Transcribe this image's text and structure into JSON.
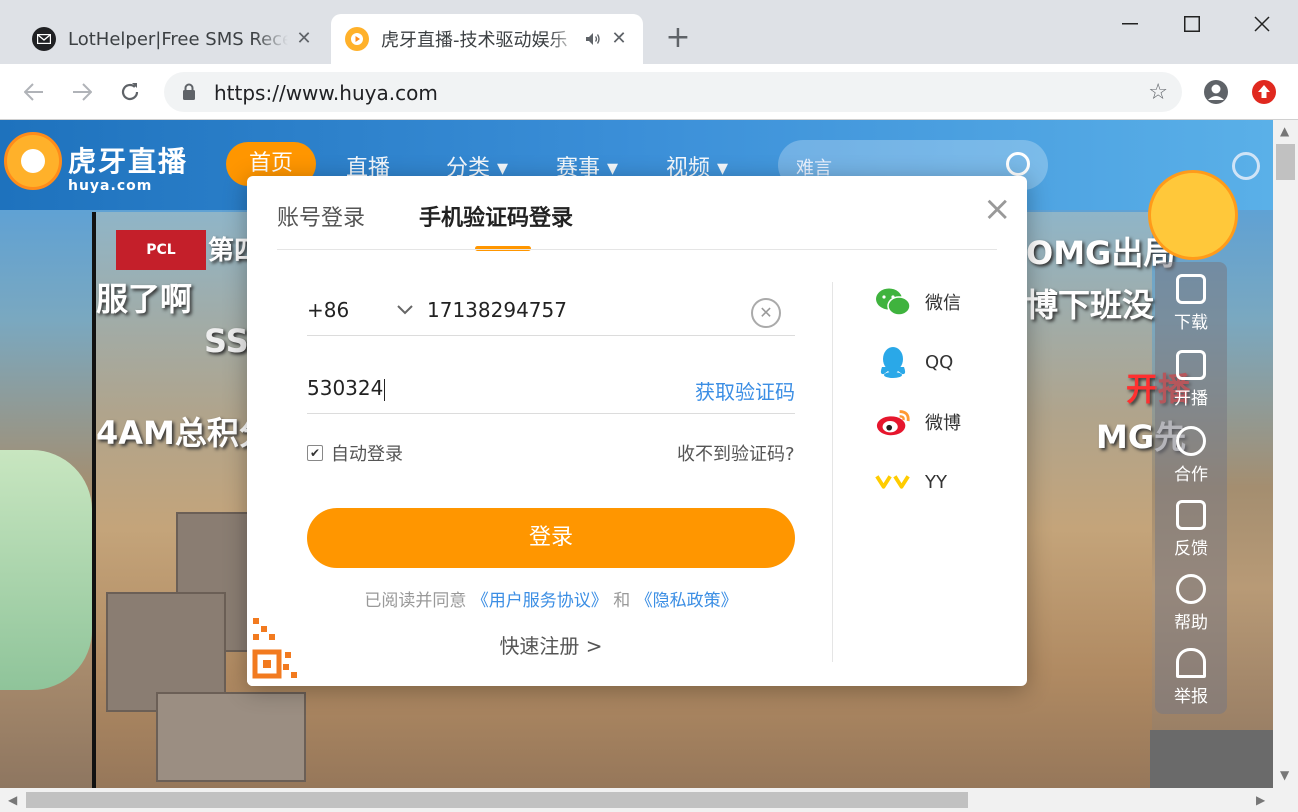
{
  "browser": {
    "tabs": [
      {
        "title": "LotHelper|Free SMS Receive",
        "active": false
      },
      {
        "title": "虎牙直播-技术驱动娱乐",
        "active": true
      }
    ],
    "url": "https://www.huya.com"
  },
  "site": {
    "brand": "虎牙直播",
    "brand_sub": "huya.com",
    "nav": [
      "首页",
      "直播",
      "分类",
      "赛事",
      "视频"
    ],
    "search_placeholder": "难言",
    "side_panel": [
      "下载",
      "开播",
      "合作",
      "反馈",
      "帮助",
      "举报"
    ],
    "overlay": {
      "pcl": "PCL",
      "round": "第四",
      "line1": "服了啊",
      "line2": "SSS",
      "line3": "4AM总积分",
      "right1": "OMG出局",
      "right2": "博下班没",
      "right3": "开播",
      "right4": "MG先"
    }
  },
  "login": {
    "tabs": [
      "账号登录",
      "手机验证码登录"
    ],
    "active_tab": 1,
    "country_code": "+86",
    "phone": "17138294757",
    "code": "530324",
    "get_code": "获取验证码",
    "remember": "自动登录",
    "no_code": "收不到验证码?",
    "submit": "登录",
    "agree_prefix": "已阅读并同意",
    "terms": "《用户服务协议》",
    "and": "和",
    "privacy": "《隐私政策》",
    "quick_register": "快速注册 >",
    "social": [
      {
        "name": "微信",
        "icon": "wechat-icon",
        "color": "#3fb33e"
      },
      {
        "name": "QQ",
        "icon": "qq-icon",
        "color": "#2aa8e8"
      },
      {
        "name": "微博",
        "icon": "weibo-icon",
        "color": "#e6162d"
      },
      {
        "name": "YY",
        "icon": "yy-icon",
        "color": "#ffcc00"
      }
    ]
  },
  "colors": {
    "accent": "#ff9600",
    "link": "#3b8ee4"
  }
}
